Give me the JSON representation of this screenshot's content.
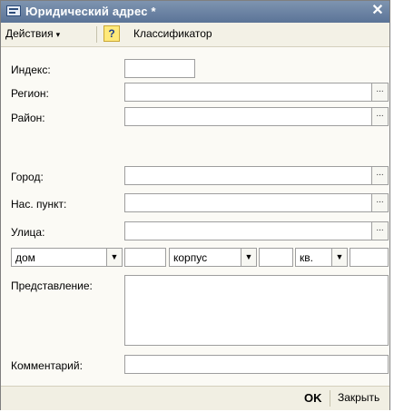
{
  "window": {
    "title": "Юридический адрес *",
    "close_glyph": "✕"
  },
  "toolbar": {
    "actions_label": "Действия",
    "actions_arrow": "▾",
    "help_glyph": "?",
    "classifier_label": "Классификатор"
  },
  "form": {
    "index_label": "Индекс:",
    "index_value": "",
    "region_label": "Регион:",
    "region_value": "",
    "district_label": "Район:",
    "district_value": "",
    "city_label": "Город:",
    "city_value": "",
    "locality_label": "Нас. пункт:",
    "locality_value": "",
    "street_label": "Улица:",
    "street_value": "",
    "select_glyph": "...",
    "house_type": "дом",
    "house_value": "",
    "building_type": "корпус",
    "building_value": "",
    "apartment_type": "кв.",
    "apartment_value": "",
    "dropdown_glyph": "▼",
    "presentation_label": "Представление:",
    "presentation_value": "",
    "comment_label": "Комментарий:",
    "comment_value": ""
  },
  "footer": {
    "ok_label": "OK",
    "close_label": "Закрыть"
  },
  "colors": {
    "titlebar": "#6a82a4",
    "window_bg": "#fbfaf5",
    "help_bg": "#ffe97a"
  }
}
